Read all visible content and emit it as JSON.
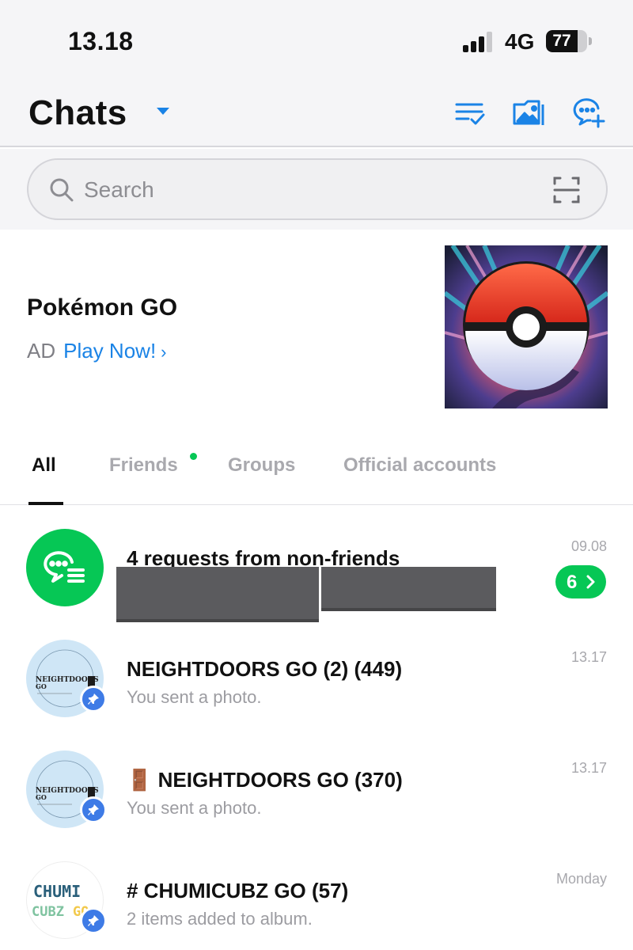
{
  "status_bar": {
    "time": "13.18",
    "network": "4G",
    "battery": "77",
    "battery_level_pct": 77
  },
  "header": {
    "title": "Chats",
    "icons": [
      "edit-list-icon",
      "photo-album-icon",
      "new-chat-icon"
    ]
  },
  "search": {
    "placeholder": "Search",
    "scan_icon": "qr-scan-icon"
  },
  "ad": {
    "title": "Pokémon GO",
    "tag": "AD",
    "cta": "Play Now!",
    "info_icon": "info-icon"
  },
  "tabs": [
    {
      "label": "All",
      "active": true
    },
    {
      "label": "Friends",
      "new_dot": true
    },
    {
      "label": "Groups"
    },
    {
      "label": "Official accounts"
    }
  ],
  "chats": [
    {
      "name": "4 requests from non-friends",
      "message": "",
      "time": "09.08",
      "badge": "6",
      "avatar_icon": "message-requests-icon",
      "accent": "#06c755"
    },
    {
      "name": "NEIGHTDOORS GO (2)  (449)",
      "message": "You sent a photo.",
      "time": "13.17",
      "pinned": true,
      "avatar_text": "NEIGHTDOORS GO"
    },
    {
      "name": "🚪 NEIGHTDOORS GO  (370)",
      "message": "You sent a photo.",
      "time": "13.17",
      "pinned": true,
      "avatar_text": "NEIGHTDOORS GO"
    },
    {
      "name": "# CHUMICUBZ GO   (57)",
      "message": "2 items added to album.",
      "time": "Monday",
      "pinned": true,
      "avatar_text": [
        "CHUMI",
        "CUBZ",
        "GO"
      ]
    }
  ],
  "colors": {
    "accent_blue": "#1a83e6",
    "line_green": "#06c755",
    "pin_blue": "#3e7be6"
  }
}
